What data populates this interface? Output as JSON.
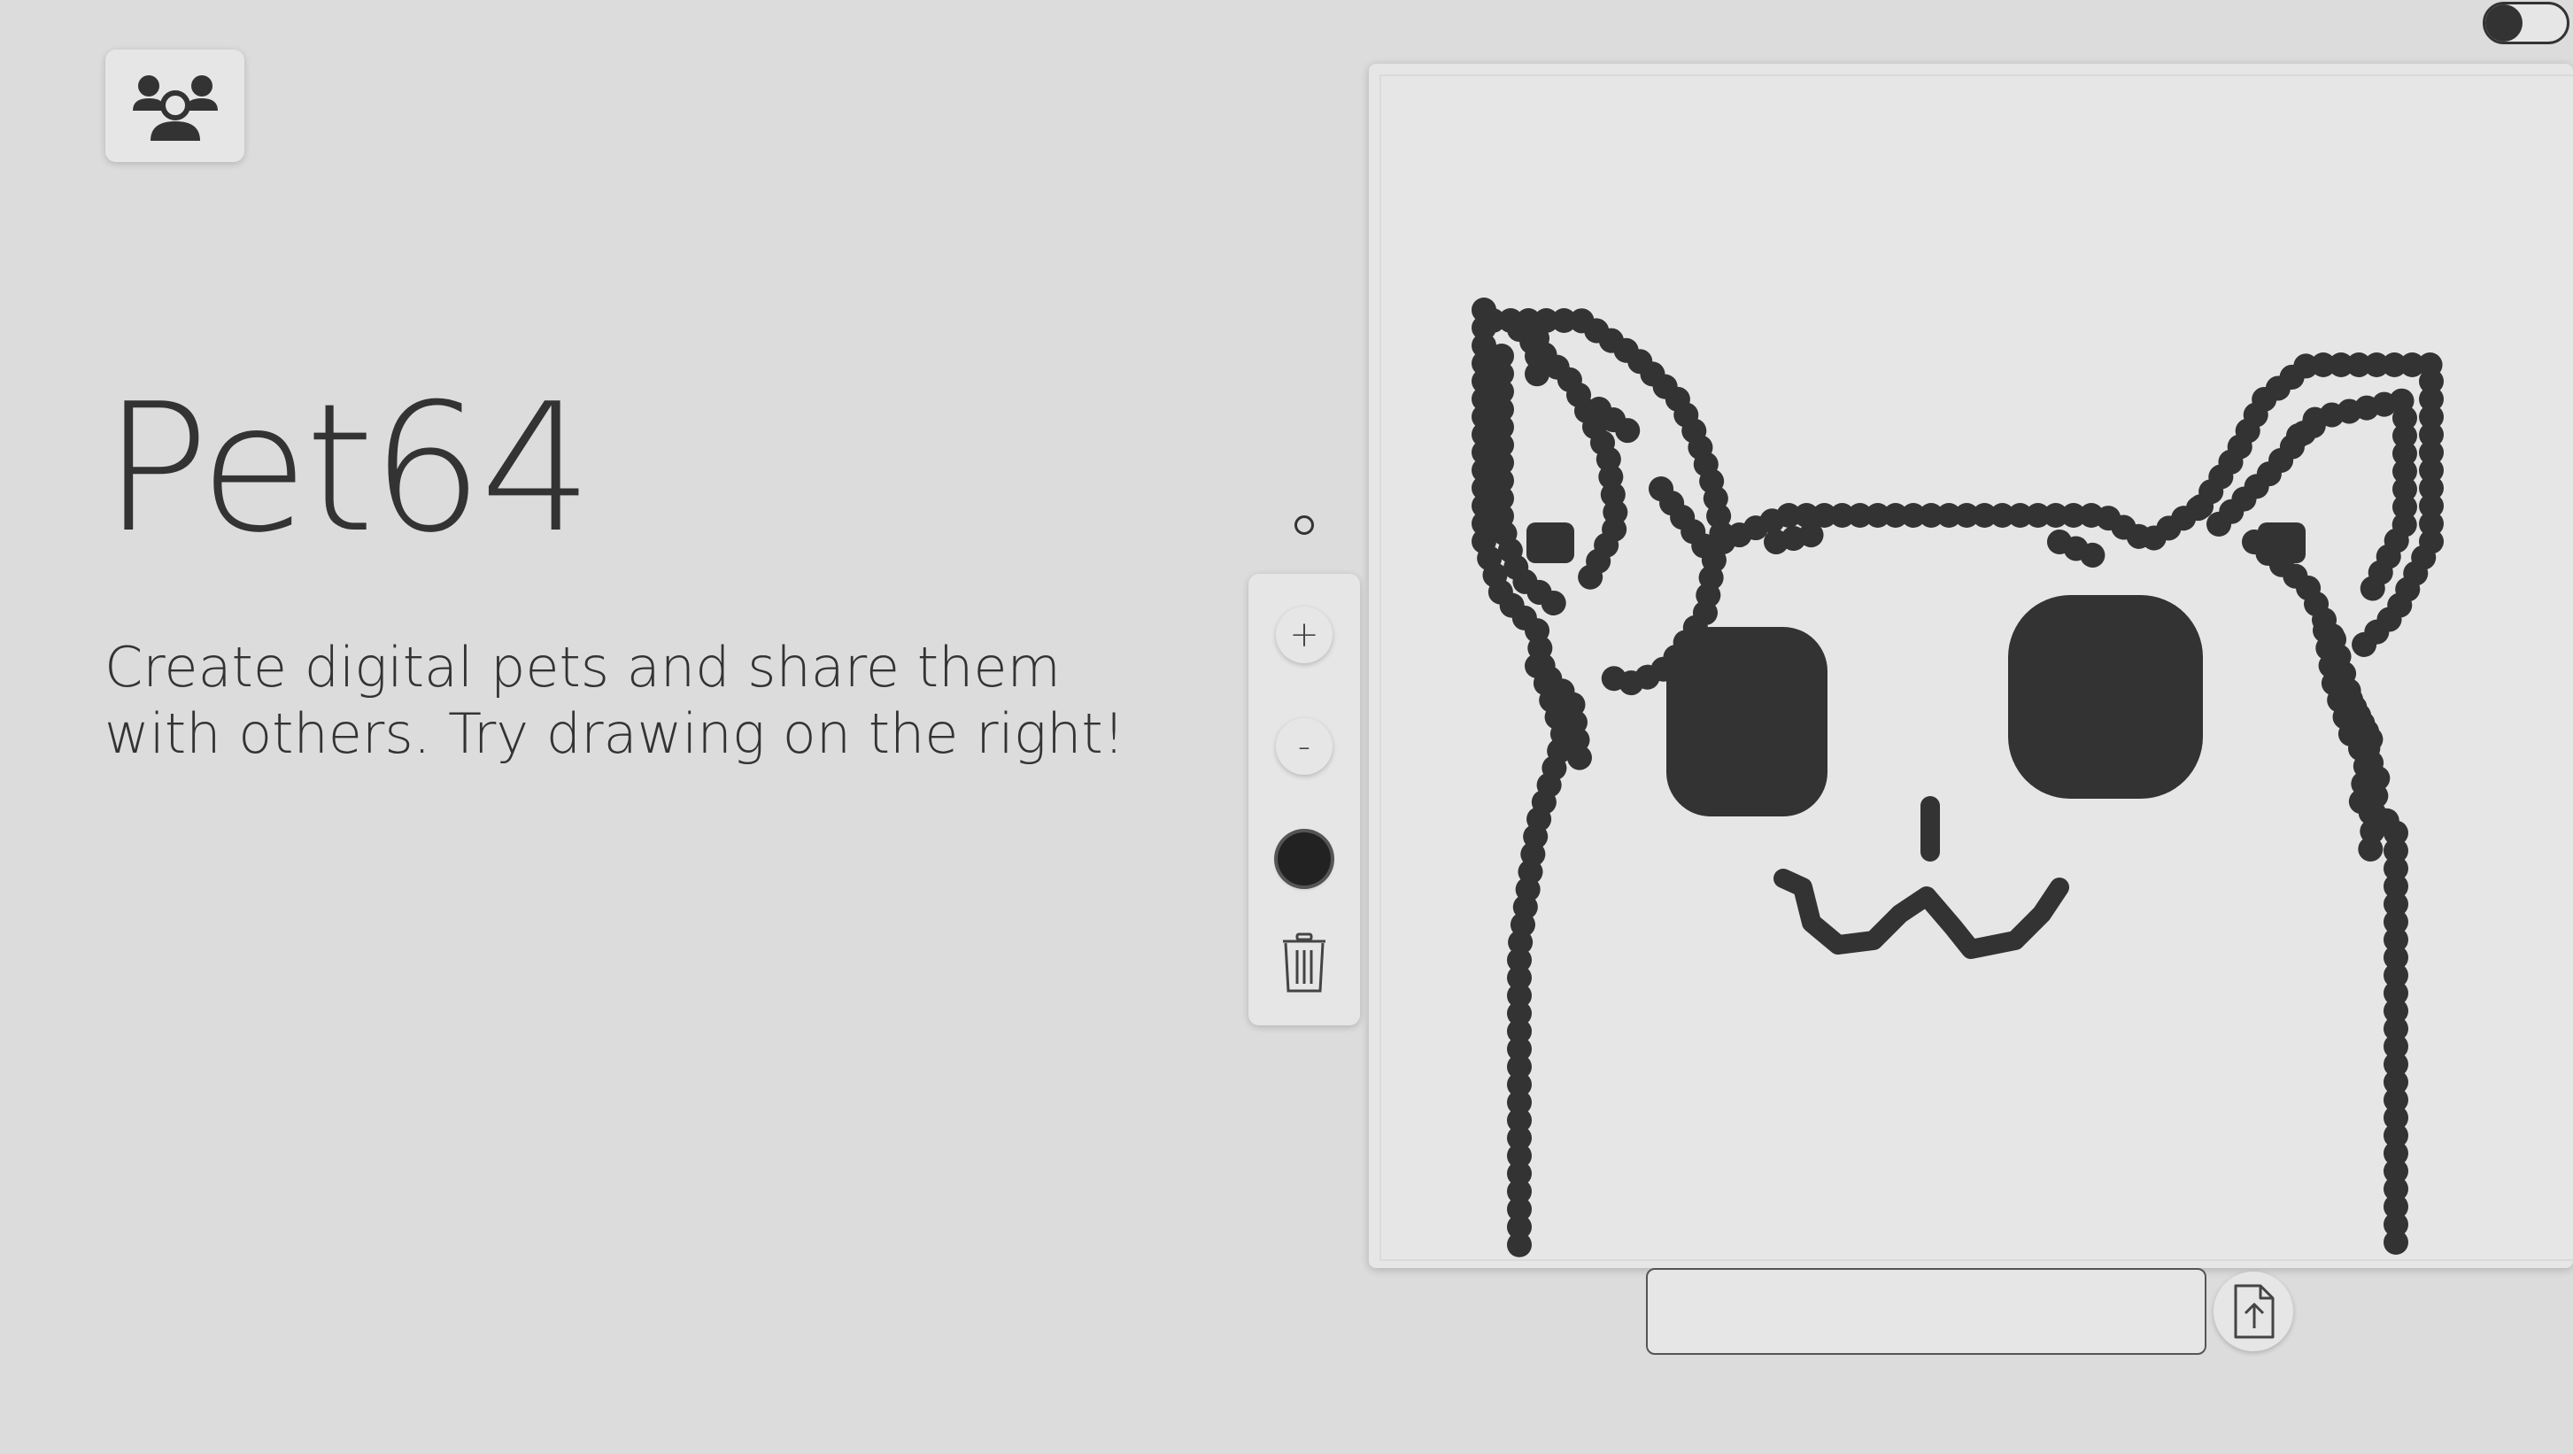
{
  "app": {
    "title": "Pet64",
    "tagline": "Create digital pets and share them with others. Try drawing on the right!"
  },
  "header": {
    "community_icon": "users-group-icon",
    "theme_toggle_state": "off"
  },
  "toolbar": {
    "zoom_in_label": "+",
    "zoom_out_label": "-",
    "brush_color": "#222222",
    "clear_icon": "trash-icon",
    "brush_size_icon": "circle-icon"
  },
  "canvas": {
    "background": "#e6e6e6",
    "ink": "#333333",
    "drawing": "cat"
  },
  "pet_name": {
    "value": "",
    "placeholder": ""
  },
  "upload": {
    "icon": "file-upload-icon"
  },
  "colors": {
    "background": "#dcdcdc",
    "surface": "#e6e6e6",
    "text": "#333333"
  }
}
